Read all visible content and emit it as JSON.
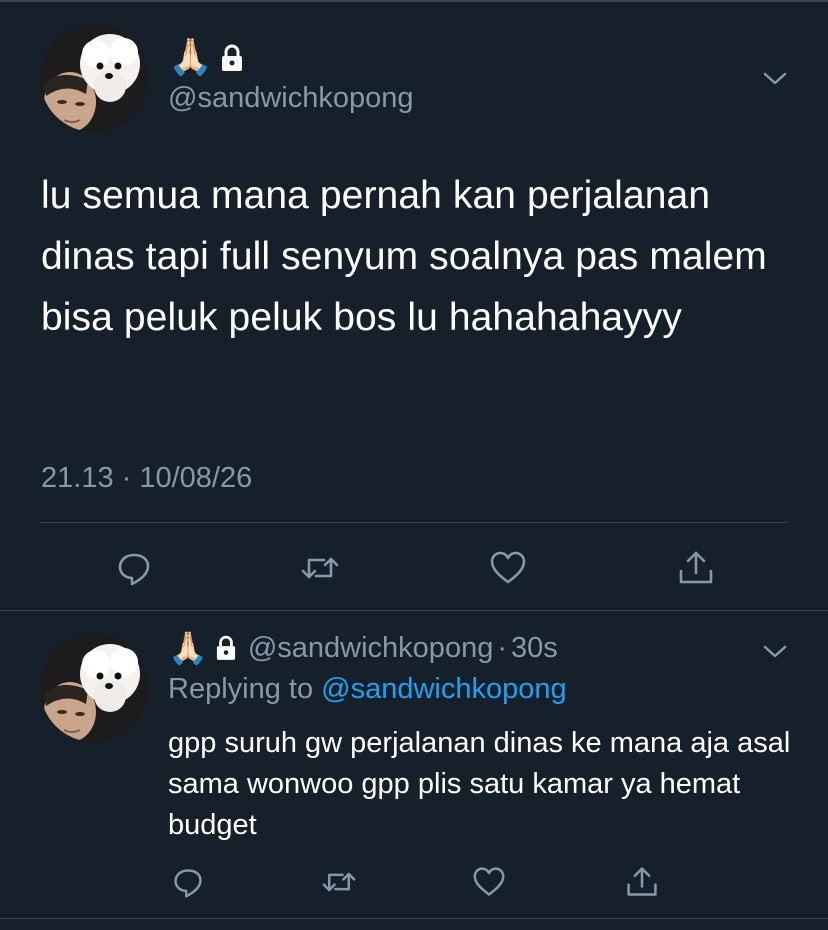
{
  "colors": {
    "background": "#15202b",
    "primary_text": "#ffffff",
    "secondary_text": "#8899a6",
    "link": "#1da1f2",
    "divider": "#38444d"
  },
  "main_tweet": {
    "display_name_emoji": "🙏🏻",
    "lock_icon": "lock-icon",
    "handle": "@sandwichkopong",
    "text": "lu semua mana pernah kan perjalanan dinas tapi full senyum soalnya pas malem bisa peluk peluk bos lu hahahahayyy",
    "timestamp": "21.13 · 10/08/26",
    "actions": [
      "reply-icon",
      "retweet-icon",
      "like-icon",
      "share-icon"
    ]
  },
  "reply_tweet": {
    "display_name_emoji": "🙏🏻",
    "handle": "@sandwichkopong",
    "separator": "·",
    "time": "30s",
    "replying_prefix": "Replying to ",
    "replying_mention": "@sandwichkopong",
    "text": "gpp suruh gw perjalanan dinas ke mana aja asal sama wonwoo gpp plis satu kamar ya hemat budget",
    "actions": [
      "reply-icon",
      "retweet-icon",
      "like-icon",
      "share-icon"
    ]
  }
}
